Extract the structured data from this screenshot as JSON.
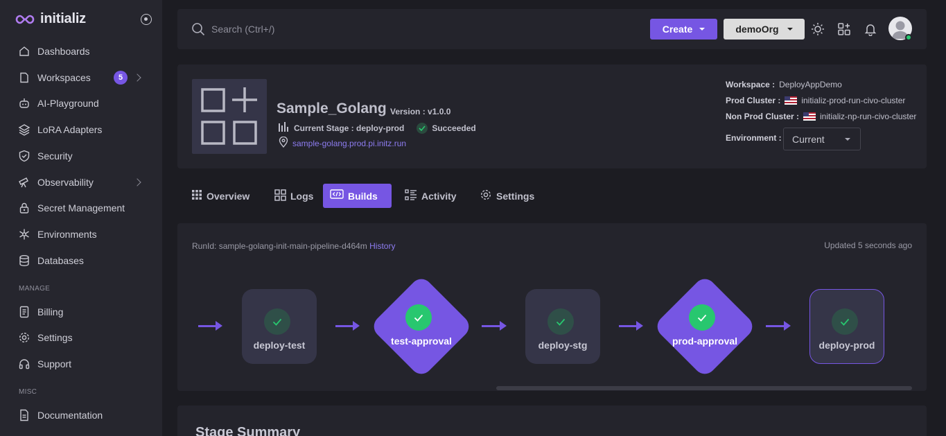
{
  "brand": {
    "name": "initializ"
  },
  "sidebar": {
    "items": [
      {
        "label": "Dashboards",
        "icon": "home-icon"
      },
      {
        "label": "Workspaces",
        "icon": "file-icon",
        "badge": "5"
      },
      {
        "label": "AI-Playground",
        "icon": "robot-icon"
      },
      {
        "label": "LoRA Adapters",
        "icon": "layers-icon"
      },
      {
        "label": "Security",
        "icon": "shield-icon"
      },
      {
        "label": "Observability",
        "icon": "telescope-icon"
      },
      {
        "label": "Secret Management",
        "icon": "lock-icon"
      },
      {
        "label": "Environments",
        "icon": "snowflake-icon"
      },
      {
        "label": "Databases",
        "icon": "database-icon"
      }
    ],
    "manage_label": "MANAGE",
    "manage_items": [
      {
        "label": "Billing",
        "icon": "receipt-icon"
      },
      {
        "label": "Settings",
        "icon": "gear-icon"
      },
      {
        "label": "Support",
        "icon": "headphones-icon"
      }
    ],
    "misc_label": "MISC",
    "misc_items": [
      {
        "label": "Documentation",
        "icon": "document-icon"
      }
    ]
  },
  "topbar": {
    "search_placeholder": "Search (Ctrl+/)",
    "create_label": "Create",
    "org_label": "demoOrg"
  },
  "app": {
    "name": "Sample_Golang",
    "version": "Version : v1.0.0",
    "current_stage": "Current Stage : deploy-prod",
    "status": "Succeeded",
    "url": "sample-golang.prod.pi.initz.run",
    "workspace_label": "Workspace :",
    "workspace_value": "DeployAppDemo",
    "prod_cluster_label": "Prod Cluster :",
    "prod_cluster_value": "initializ-prod-run-civo-cluster",
    "nonprod_cluster_label": "Non Prod Cluster :",
    "nonprod_cluster_value": "initializ-np-run-civo-cluster",
    "environment_label": "Environment :",
    "environment_value": "Current"
  },
  "tabs": [
    {
      "label": "Overview",
      "active": false
    },
    {
      "label": "Logs",
      "active": false
    },
    {
      "label": "Builds",
      "active": true
    },
    {
      "label": "Activity",
      "active": false
    },
    {
      "label": "Settings",
      "active": false
    }
  ],
  "builds": {
    "runid_text": "RunId: sample-golang-init-main-pipeline-d464m",
    "history_label": "History",
    "updated_text": "Updated 5 seconds ago",
    "stages": [
      {
        "label": "deploy-test",
        "kind": "deploy",
        "status": "succeeded"
      },
      {
        "label": "test-approval",
        "kind": "approval",
        "status": "succeeded"
      },
      {
        "label": "deploy-stg",
        "kind": "deploy",
        "status": "succeeded"
      },
      {
        "label": "prod-approval",
        "kind": "approval",
        "status": "succeeded"
      },
      {
        "label": "deploy-prod",
        "kind": "deploy",
        "status": "succeeded"
      }
    ]
  },
  "summary": {
    "title": "Stage Summary"
  },
  "colors": {
    "accent": "#7656e3",
    "success": "#28c76f",
    "panel": "#24242c",
    "sidebar": "#26262e",
    "background": "#1c1c22"
  }
}
